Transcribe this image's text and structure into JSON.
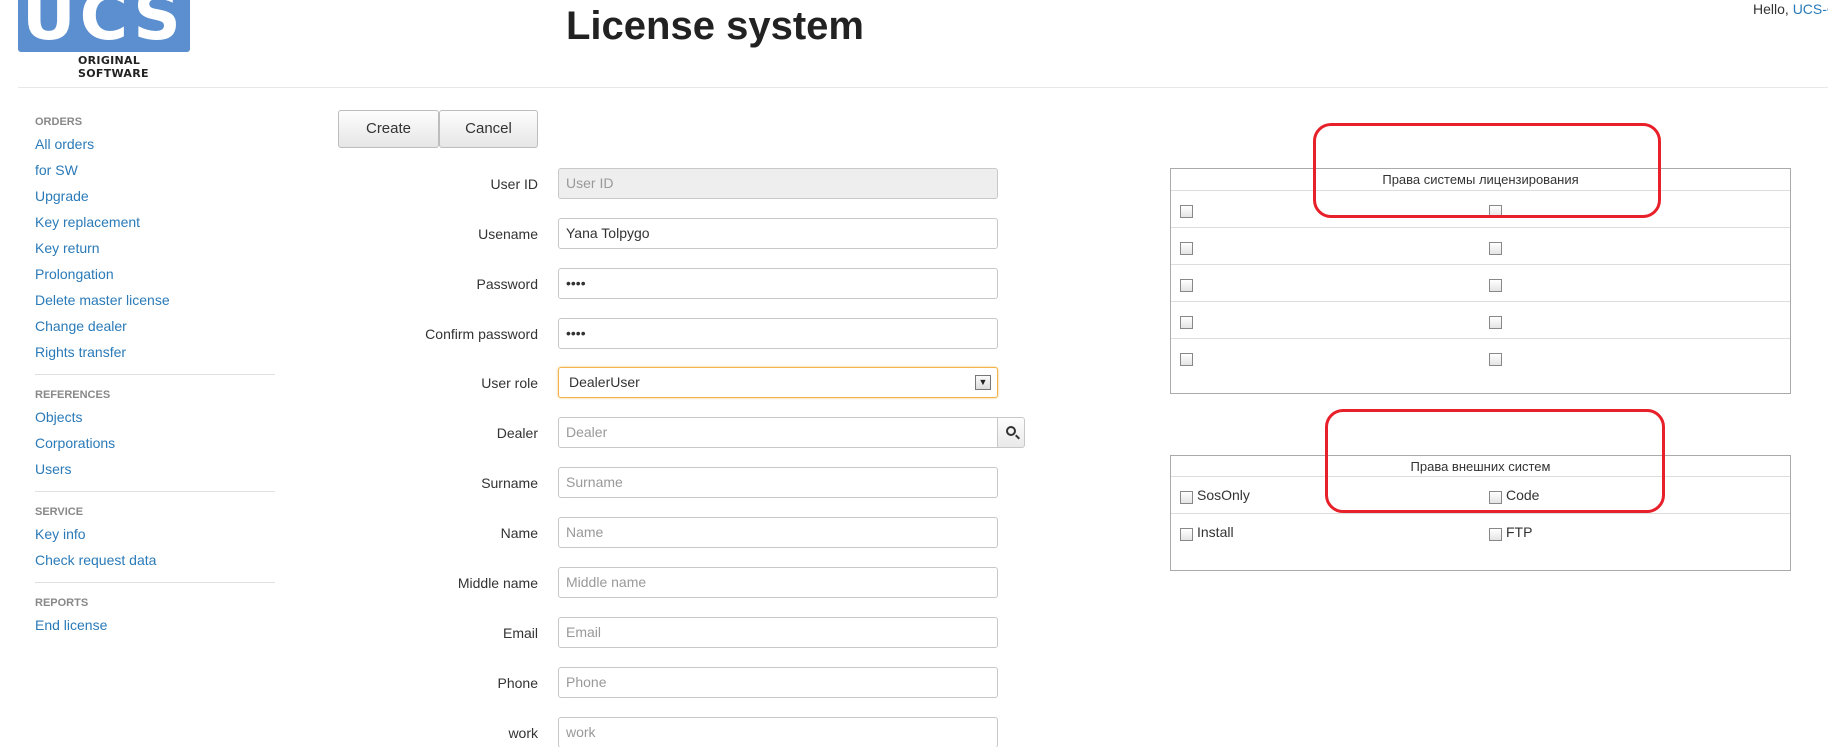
{
  "header": {
    "logo_text": "UCS",
    "logo_subtitle": "ORIGINAL SOFTWARE",
    "title": "License system",
    "greeting": "Hello,",
    "user_link": "UCS-C"
  },
  "sidebar": {
    "sections": [
      {
        "header": "ORDERS",
        "items": [
          "All orders",
          "for SW",
          "Upgrade",
          "Key replacement",
          "Key return",
          "Prolongation",
          "Delete master license",
          "Change dealer",
          "Rights transfer"
        ]
      },
      {
        "header": "REFERENCES",
        "items": [
          "Objects",
          "Corporations",
          "Users"
        ]
      },
      {
        "header": "SERVICE",
        "items": [
          "Key info",
          "Check request data"
        ]
      },
      {
        "header": "REPORTS",
        "items": [
          "End license"
        ]
      }
    ]
  },
  "toolbar": {
    "create_label": "Create",
    "cancel_label": "Cancel"
  },
  "form": {
    "user_id": {
      "label": "User ID",
      "value": "",
      "placeholder": "User ID"
    },
    "username": {
      "label": "Usename",
      "value": "Yana Tolpygo",
      "placeholder": ""
    },
    "password": {
      "label": "Password",
      "value": "••••",
      "placeholder": ""
    },
    "confirm_password": {
      "label": "Confirm password",
      "value": "••••",
      "placeholder": ""
    },
    "user_role": {
      "label": "User role",
      "value": "DealerUser"
    },
    "dealer": {
      "label": "Dealer",
      "value": "",
      "placeholder": "Dealer"
    },
    "surname": {
      "label": "Surname",
      "value": "",
      "placeholder": "Surname"
    },
    "name": {
      "label": "Name",
      "value": "",
      "placeholder": "Name"
    },
    "middle_name": {
      "label": "Middle name",
      "value": "",
      "placeholder": "Middle name"
    },
    "email": {
      "label": "Email",
      "value": "",
      "placeholder": "Email"
    },
    "phone": {
      "label": "Phone",
      "value": "",
      "placeholder": "Phone"
    },
    "work": {
      "label": "work",
      "value": "",
      "placeholder": "work"
    }
  },
  "licensing_rights": {
    "title": "Права системы лицензирования",
    "rows": 5
  },
  "external_rights": {
    "title": "Права внешних систем",
    "items": [
      {
        "label": "SosOnly",
        "checked": false
      },
      {
        "label": "Code",
        "checked": false
      },
      {
        "label": "Install",
        "checked": false
      },
      {
        "label": "FTP",
        "checked": false
      }
    ]
  },
  "colors": {
    "link": "#2a7ab8",
    "highlight": "#e8202a",
    "logo": "#5b8fd0"
  }
}
